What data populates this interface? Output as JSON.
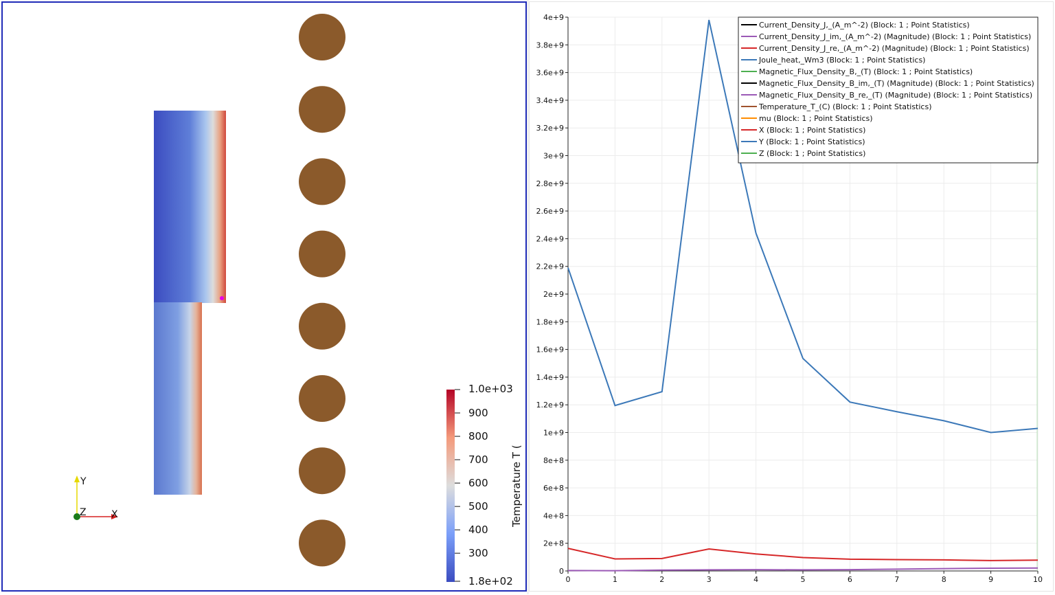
{
  "render_view": {
    "colorbar": {
      "title": "Temperature T (",
      "max_label": "1.0e+03",
      "min_label": "1.8e+02",
      "tick_labels": [
        "900",
        "800",
        "700",
        "600",
        "500",
        "400",
        "300"
      ]
    },
    "axes_labels": {
      "x": "X",
      "y": "Y",
      "z": "Z"
    },
    "coil_count": 8,
    "colors": {
      "cold": "#3b4cc0",
      "hot": "#b40426",
      "coil": "#8b5a2b",
      "frame": "#1f2bb8",
      "marker": "#e600e6"
    }
  },
  "chart_data": {
    "type": "line",
    "x": [
      0,
      1,
      2,
      3,
      4,
      5,
      6,
      7,
      8,
      9,
      10
    ],
    "xlim": [
      0,
      10
    ],
    "ylim": [
      0,
      4000000000
    ],
    "x_tick_labels": [
      "0",
      "1",
      "2",
      "3",
      "4",
      "5",
      "6",
      "7",
      "8",
      "9",
      "10"
    ],
    "y_tick_labels": [
      "0",
      "2e+8",
      "4e+8",
      "6e+8",
      "8e+8",
      "1e+9",
      "1.2e+9",
      "1.4e+9",
      "1.6e+9",
      "1.8e+9",
      "2e+9",
      "2.2e+9",
      "2.4e+9",
      "2.6e+9",
      "2.8e+9",
      "3e+9",
      "3.2e+9",
      "3.4e+9",
      "3.6e+9",
      "3.8e+9",
      "4e+9"
    ],
    "grid": true,
    "legend_position": "top-right",
    "series": [
      {
        "name": "Current_Density_J,_(A_m^-2) (Block: 1 ; Point Statistics)",
        "color": "#000000",
        "values": null
      },
      {
        "name": "Current_Density_J_im,_(A_m^-2) (Magnitude) (Block: 1 ; Point Statistics)",
        "color": "#9b59b6",
        "values": [
          3000000,
          2000000,
          6000000,
          8000000,
          9000000,
          8000000,
          9000000,
          13000000,
          17000000,
          20000000,
          21000000
        ]
      },
      {
        "name": "Current_Density_J_re,_(A_m^-2) (Magnitude) (Block: 1 ; Point Statistics)",
        "color": "#d62728",
        "values": [
          163000000,
          87000000,
          90000000,
          159000000,
          123000000,
          97000000,
          85000000,
          82000000,
          80000000,
          75000000,
          78000000
        ]
      },
      {
        "name": "Joule_heat,_Wm3 (Block: 1 ; Point Statistics)",
        "color": "#3b78b8",
        "values": [
          2190000000,
          1195000000,
          1295000000,
          3980000000,
          2440000000,
          1535000000,
          1220000000,
          1150000000,
          1085000000,
          1000000000,
          1030000000
        ]
      },
      {
        "name": "Magnetic_Flux_Density_B,_(T) (Block: 1 ; Point Statistics)",
        "color": "#4caf50",
        "values": null
      },
      {
        "name": "Magnetic_Flux_Density_B_im,_(T) (Magnitude) (Block: 1 ; Point Statistics)",
        "color": "#000000",
        "values": null
      },
      {
        "name": "Magnetic_Flux_Density_B_re,_(T) (Magnitude) (Block: 1 ; Point Statistics)",
        "color": "#9b59b6",
        "values": null
      },
      {
        "name": "Temperature_T_(C) (Block: 1 ; Point Statistics)",
        "color": "#a0522d",
        "values": null
      },
      {
        "name": "mu (Block: 1 ; Point Statistics)",
        "color": "#ff8c00",
        "values": null
      },
      {
        "name": "X (Block: 1 ; Point Statistics)",
        "color": "#d62728",
        "values": null
      },
      {
        "name": "Y (Block: 1 ; Point Statistics)",
        "color": "#3b78b8",
        "values": null
      },
      {
        "name": "Z (Block: 1 ; Point Statistics)",
        "color": "#4caf50",
        "values": null
      }
    ]
  }
}
